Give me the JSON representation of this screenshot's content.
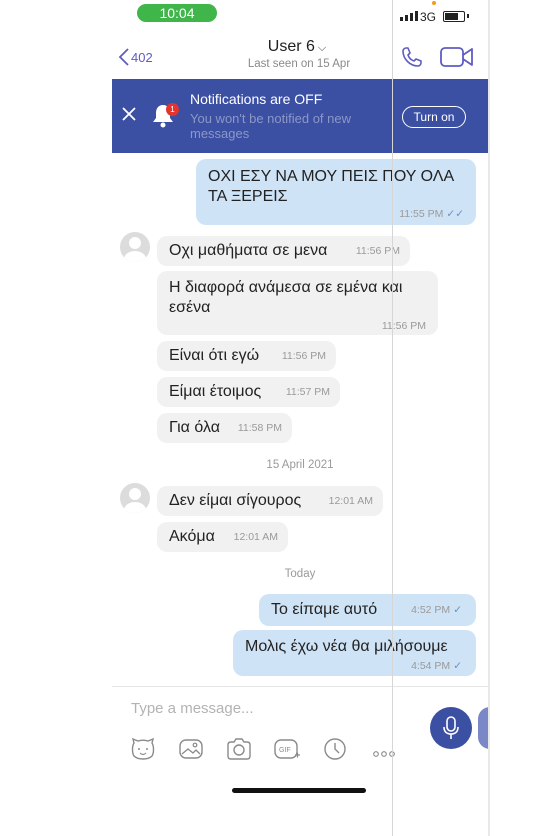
{
  "status_bar": {
    "time": "10:04",
    "network": "3G"
  },
  "header": {
    "back_count": "402",
    "contact_name": "User 6",
    "last_seen": "Last seen on 15 Apr"
  },
  "banner": {
    "title": "Notifications are OFF",
    "subtitle": "You won't be notified of new messages",
    "button": "Turn on",
    "badge": "1"
  },
  "messages": [
    {
      "dir": "out",
      "text": "ΟΧΙ ΕΣΥ ΝΑ ΜΟΥ ΠΕΙΣ ΠΟΥ ΟΛΑ ΤΑ ΞΕΡΕΙΣ",
      "time": "11:55 PM",
      "status": "read"
    },
    {
      "dir": "in",
      "text": "Οχι μαθήματα σε μενα",
      "time": "11:56 PM"
    },
    {
      "dir": "in",
      "text": "Η διαφορά ανάμεσα σε εμένα και εσένα",
      "time": "11:56 PM"
    },
    {
      "dir": "in",
      "text": "Είναι ότι εγώ",
      "time": "11:56 PM"
    },
    {
      "dir": "in",
      "text": "Είμαι έτοιμος",
      "time": "11:57 PM"
    },
    {
      "dir": "in",
      "text": "Για όλα",
      "time": "11:58 PM"
    },
    {
      "dir": "in",
      "text": "Δεν είμαι σίγουρος",
      "time": "12:01 AM"
    },
    {
      "dir": "in",
      "text": "Ακόμα",
      "time": "12:01 AM"
    },
    {
      "dir": "out",
      "text": "Το είπαμε αυτό",
      "time": "4:52 PM",
      "status": "sent"
    },
    {
      "dir": "out",
      "text": "Μολις έχω νέα θα μιλήσουμε",
      "time": "4:54 PM",
      "status": "sent"
    }
  ],
  "date_separators": [
    "15 April 2021",
    "Today"
  ],
  "composer": {
    "placeholder": "Type a message...",
    "tools": [
      "sticker-icon",
      "gallery-icon",
      "camera-icon",
      "gif-icon",
      "timer-icon",
      "more-icon"
    ],
    "gif_label": "GIF"
  },
  "colors": {
    "brand": "#3b4fa3",
    "outgoing_bubble": "#cfe3f6",
    "incoming_bubble": "#f1f1f1",
    "status_green": "#3fb54a",
    "link_purple": "#5f5cc4"
  }
}
